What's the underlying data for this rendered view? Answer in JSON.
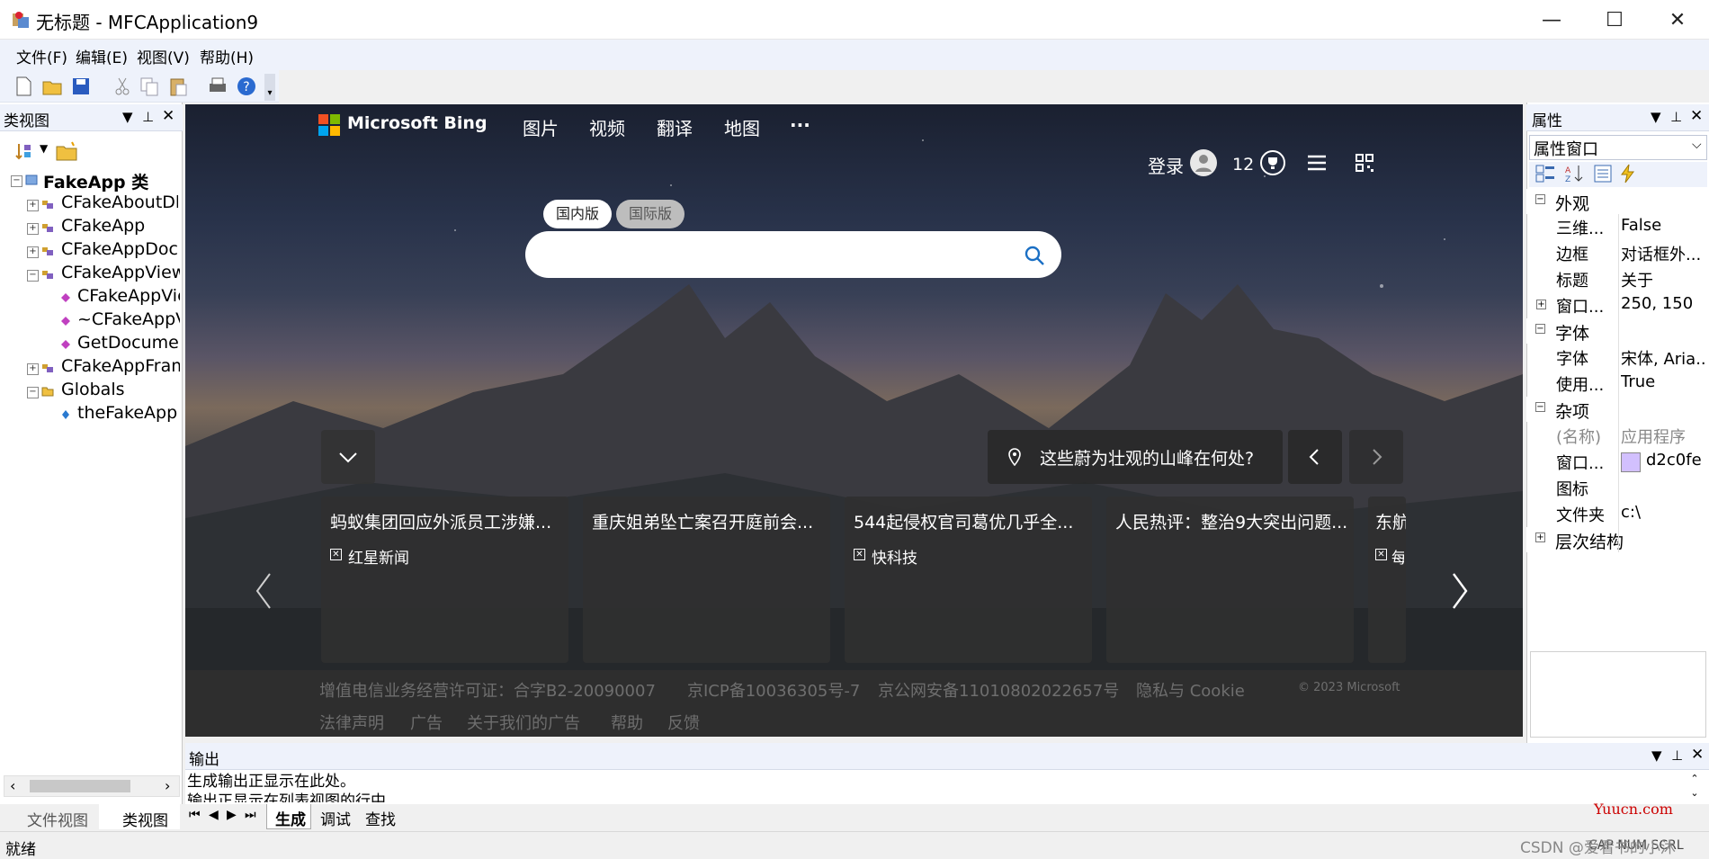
{
  "window": {
    "title": "无标题 - MFCApplication9",
    "minimize": "—",
    "maximize": "☐",
    "close": "✕"
  },
  "menu": [
    "文件(F)",
    "编辑(E)",
    "视图(V)",
    "帮助(H)"
  ],
  "class_view": {
    "title": "类视图",
    "root": "FakeApp 类",
    "items": [
      "CFakeAboutDlg",
      "CFakeApp",
      "CFakeAppDoc",
      "CFakeAppView",
      "CFakeAppView()",
      "~CFakeAppView()",
      "GetDocument()",
      "CFakeAppFrame",
      "Globals",
      "theFakeApp"
    ],
    "tabs": [
      "文件视图",
      "类视图"
    ]
  },
  "bing": {
    "brand": "Microsoft Bing",
    "nav": [
      "图片",
      "视频",
      "翻译",
      "地图",
      "···"
    ],
    "login": "登录",
    "points": "12",
    "tab_cn": "国内版",
    "tab_intl": "国际版",
    "search_placeholder": "",
    "question": "这些蔚为壮观的山峰在何处?",
    "cards": [
      {
        "title": "蚂蚁集团回应外派员工涉嫌...",
        "source": "红星新闻"
      },
      {
        "title": "重庆姐弟坠亡案召开庭前会...",
        "source": ""
      },
      {
        "title": "544起侵权官司葛优几乎全...",
        "source": "快科技"
      },
      {
        "title": "人民热评：整治9大突出问题...",
        "source": ""
      },
      {
        "title": "东航",
        "source": "每"
      }
    ],
    "footer_row1": [
      "增值电信业务经营许可证：合字B2-20090007",
      "京ICP备10036305号-7",
      "京公网安备11010802022657号",
      "隐私与 Cookie"
    ],
    "copyright": "© 2023 Microsoft",
    "footer_row2": [
      "法律声明",
      "广告",
      "关于我们的广告",
      "帮助",
      "反馈"
    ]
  },
  "properties": {
    "title": "属性",
    "selector": "属性窗口",
    "categories": [
      {
        "name": "外观",
        "rows": [
          [
            "三维...",
            "False"
          ],
          [
            "边框",
            "对话框外..."
          ],
          [
            "标题",
            "关于"
          ],
          [
            "窗口...",
            "250, 150"
          ]
        ]
      },
      {
        "name": "字体",
        "rows": [
          [
            "字体",
            "宋体, Aria..."
          ],
          [
            "使用...",
            "True"
          ]
        ]
      },
      {
        "name": "杂项",
        "rows": [
          [
            "(名称)",
            "应用程序"
          ],
          [
            "窗口...",
            "d2c0fe"
          ],
          [
            "图标",
            ""
          ],
          [
            "文件夹",
            "c:\\"
          ]
        ]
      },
      {
        "name": "层次结构",
        "rows": []
      }
    ],
    "swatch_color": "#d2c0fe"
  },
  "output": {
    "title": "输出",
    "line1": "生成输出正显示在此处。",
    "line2": "输出正显示在列表视图的行中",
    "tabs": [
      "生成",
      "调试",
      "查找"
    ]
  },
  "status": {
    "left": "就绪",
    "right": "CAP NUM SCRL",
    "watermark": "CSDN @爱看书的小沐",
    "yuucn": "Yuucn.com"
  }
}
